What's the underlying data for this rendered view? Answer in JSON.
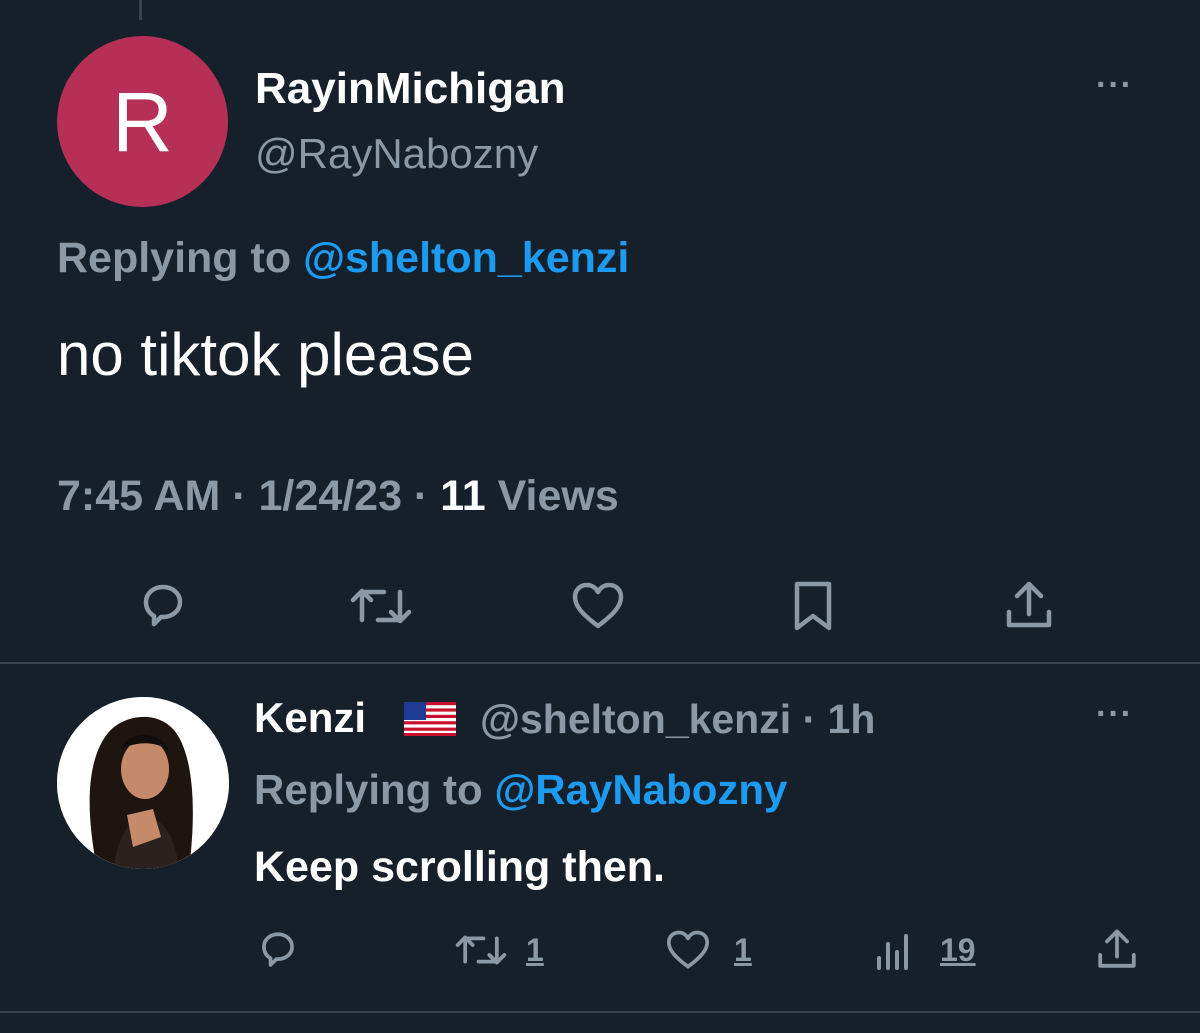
{
  "tweet": {
    "display_name": "RayinMichigan",
    "handle": "@RayNabozny",
    "avatar_letter": "R",
    "avatar_color": "#b52f57",
    "replying_prefix": "Replying to",
    "replying_handle": "@shelton_kenzi",
    "text": "no tiktok please",
    "time": "7:45 AM",
    "sep1": " · ",
    "date": "1/24/23",
    "sep2": " · ",
    "views_count": "11",
    "views_label": " Views",
    "more_label": "···",
    "actions": [
      "reply-icon",
      "retweet-icon",
      "like-icon",
      "bookmark-icon",
      "share-icon"
    ]
  },
  "reply": {
    "display_name": "Kenzi",
    "flag_icon": "us-flag-icon",
    "handle": "@shelton_kenzi",
    "age": " · 1h",
    "replying_prefix": "Replying to",
    "replying_handle": "@RayNabozny",
    "text": "Keep scrolling then.",
    "more_label": "···",
    "retweets": "1",
    "likes": "1",
    "views": "19",
    "actions": [
      "reply-icon",
      "retweet-icon",
      "like-icon",
      "views-icon",
      "share-icon"
    ]
  },
  "colors": {
    "background": "#15202b",
    "secondary_text": "#8b98a5",
    "link": "#1d9bf0",
    "divider": "#38444d"
  }
}
